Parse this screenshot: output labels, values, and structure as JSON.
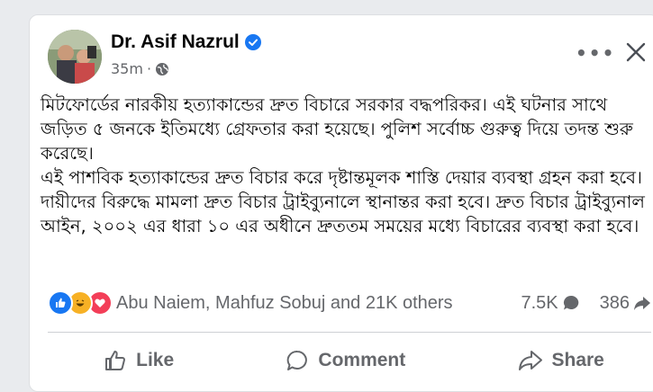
{
  "post": {
    "author": "Dr. Asif Nazrul",
    "time": "35m",
    "text": "মিটফোর্ডের নারকীয় হত্যাকান্ডের দ্রুত বিচারে সরকার বদ্ধপরিকর। এই ঘটনার সাথে জড়িত ৫ জনকে ইতিমধ্যে গ্রেফতার করা হয়েছে। পুলিশ সর্বোচ্চ গুরুত্ব দিয়ে তদন্ত শুরু করেছে।\nএই পাশবিক হত্যাকান্ডের দ্রুত বিচার করে দৃষ্টান্তমূলক শাস্তি দেয়ার ব্যবস্থা গ্রহন করা হবে। দায়ীদের বিরুদ্ধে মামলা দ্রুত বিচার ট্রাইব্যুনালে স্থানান্তর করা হবে। দ্রুত বিচার ট্রাইব্যুনাল আইন, ২০০২ এর ধারা ১০ এর অধীনে দ্রুততম সময়ের মধ্যে বিচারের ব্যবস্থা করা হবে।"
  },
  "reactions": {
    "summary": "Abu Naiem, Mahfuz Sobuj and 21K others",
    "comments": "7.5K",
    "shares": "386",
    "icons": [
      "like",
      "haha",
      "love"
    ]
  },
  "actions": {
    "like": "Like",
    "comment": "Comment",
    "share": "Share"
  },
  "colors": {
    "accent": "#1877f2",
    "text_secondary": "#65676b",
    "love": "#f33e58",
    "haha": "#f7b125"
  }
}
